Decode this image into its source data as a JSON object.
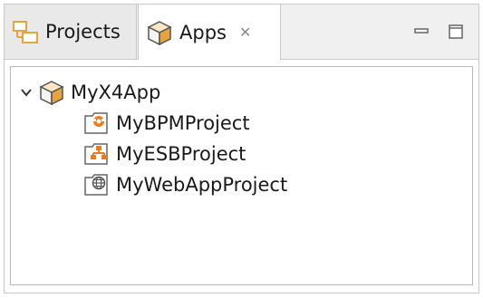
{
  "tabs": {
    "projects_label": "Projects",
    "apps_label": "Apps",
    "close_glyph": "✕"
  },
  "tree": {
    "root": {
      "label": "MyX4App",
      "expanded": true,
      "icon": "package-icon"
    },
    "children": [
      {
        "label": "MyBPMProject",
        "icon": "bpm-project-icon"
      },
      {
        "label": "MyESBProject",
        "icon": "esb-project-icon"
      },
      {
        "label": "MyWebAppProject",
        "icon": "webapp-project-icon"
      }
    ]
  },
  "colors": {
    "folder": "#e8a33c",
    "accent_orange": "#f07a1a",
    "border": "#c8c8c8",
    "globe": "#555555"
  }
}
